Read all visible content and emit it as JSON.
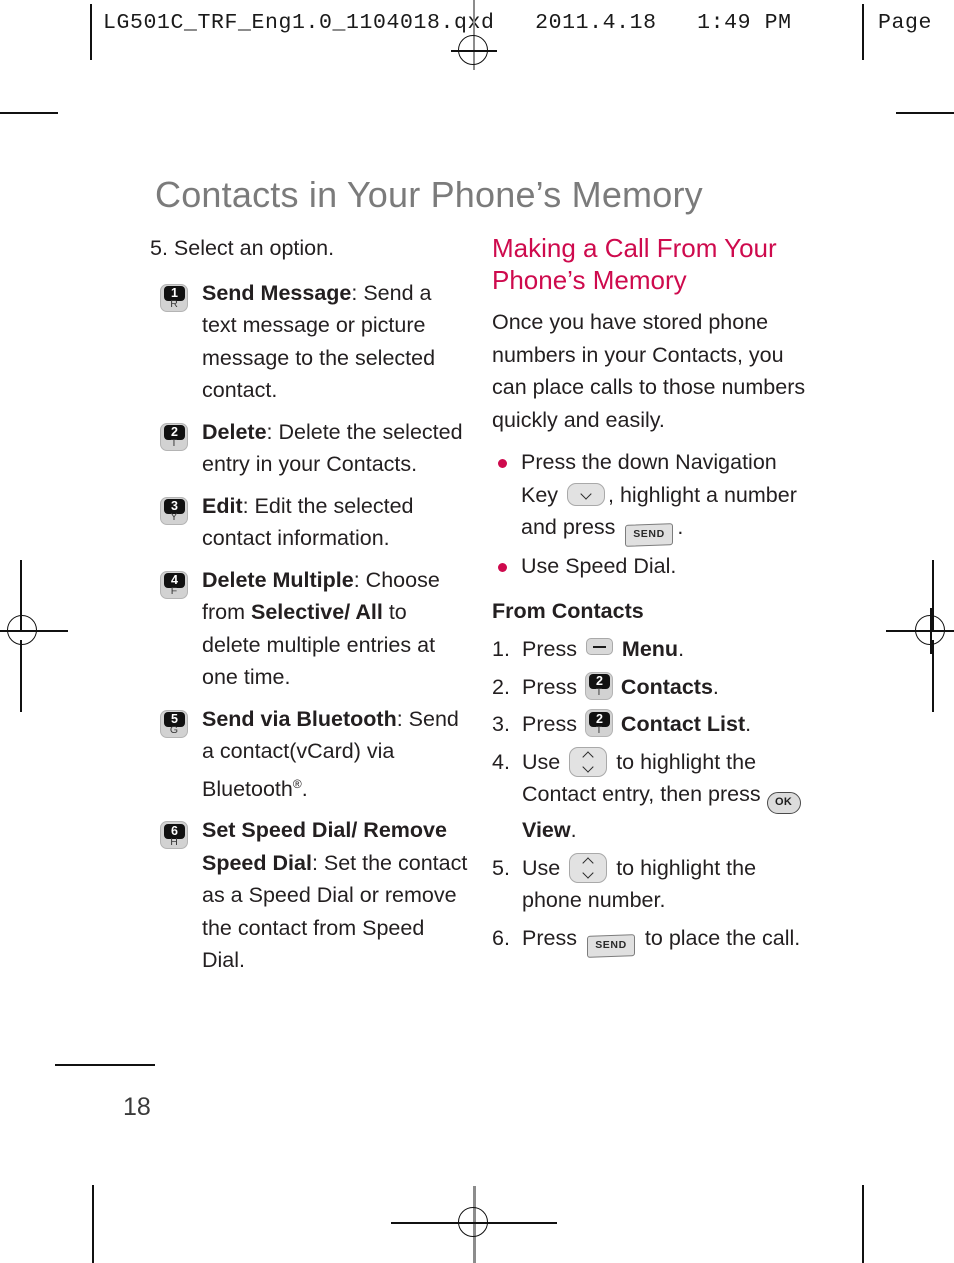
{
  "header": {
    "file_line": "LG501C_TRF_Eng1.0_1104018.qxd   2011.4.18   1:49 PM",
    "page_label": "Page"
  },
  "page_title": "Contacts in Your Phone’s Memory",
  "folio": "18",
  "left_column": {
    "lead": "5. Select an option.",
    "options": [
      {
        "key": {
          "num": "1",
          "letter": "R"
        },
        "term": "Send Message",
        "desc": ": Send a text message or picture message to the selected contact."
      },
      {
        "key": {
          "num": "2",
          "letter": "T"
        },
        "term": "Delete",
        "desc": ": Delete the selected entry in your Contacts."
      },
      {
        "key": {
          "num": "3",
          "letter": "Y"
        },
        "term": "Edit",
        "desc": ": Edit the selected contact information."
      },
      {
        "key": {
          "num": "4",
          "letter": "F"
        },
        "term": "Delete Multiple",
        "desc_a": ": Choose from ",
        "emphasis": "Selective/ All",
        "desc_b": " to delete multiple entries at one time."
      },
      {
        "key": {
          "num": "5",
          "letter": "G"
        },
        "term": "Send via Bluetooth",
        "desc": ": Send a contact(vCard) via Bluetooth",
        "superscript": "®",
        "desc_tail": "."
      },
      {
        "key": {
          "num": "6",
          "letter": "H"
        },
        "term": "Set Speed Dial/ Remove Speed Dial",
        "desc": ": Set the contact as a Speed Dial or remove the contact from Speed Dial."
      }
    ]
  },
  "right_column": {
    "section_title": "Making a Call From Your Phone’s Memory",
    "intro": "Once you have stored phone numbers in your Contacts, you can place calls to those numbers quickly and easily.",
    "bullets": [
      {
        "text_a": "Press the down Navigation Key ",
        "key_nav": "down-navigation-key",
        "text_b": ", highlight a number and press ",
        "key_send": "SEND",
        "text_c": "."
      },
      {
        "text_a": "Use Speed Dial."
      }
    ],
    "sub_head": "From Contacts",
    "steps": [
      {
        "n": "1.",
        "text_a": "Press ",
        "key_type": "soft",
        "text_b": "",
        "bold": "Menu",
        "text_c": "."
      },
      {
        "n": "2.",
        "text_a": "Press ",
        "key_type": "keycap",
        "key": {
          "num": "2",
          "letter": "T"
        },
        "bold": "Contacts",
        "text_c": "."
      },
      {
        "n": "3.",
        "text_a": "Press ",
        "key_type": "keycap",
        "key": {
          "num": "2",
          "letter": "T"
        },
        "bold": "Contact List",
        "text_c": "."
      },
      {
        "n": "4.",
        "text_a": "Use ",
        "key_type": "nav-updown",
        "text_b": " to highlight the Contact entry, then press ",
        "key_ok": "OK",
        "bold": "View",
        "text_c": "."
      },
      {
        "n": "5.",
        "text_a": "Use ",
        "key_type": "nav-updown",
        "text_b": " to highlight the phone number.",
        "bold": "",
        "text_c": ""
      },
      {
        "n": "6.",
        "text_a": "Press ",
        "key_type": "send",
        "key_send": "SEND",
        "text_b": " to place the call.",
        "bold": "",
        "text_c": ""
      }
    ]
  },
  "colors": {
    "accent": "#ce0a4d",
    "title_gray": "#7b7b7b",
    "body": "#231f20"
  }
}
